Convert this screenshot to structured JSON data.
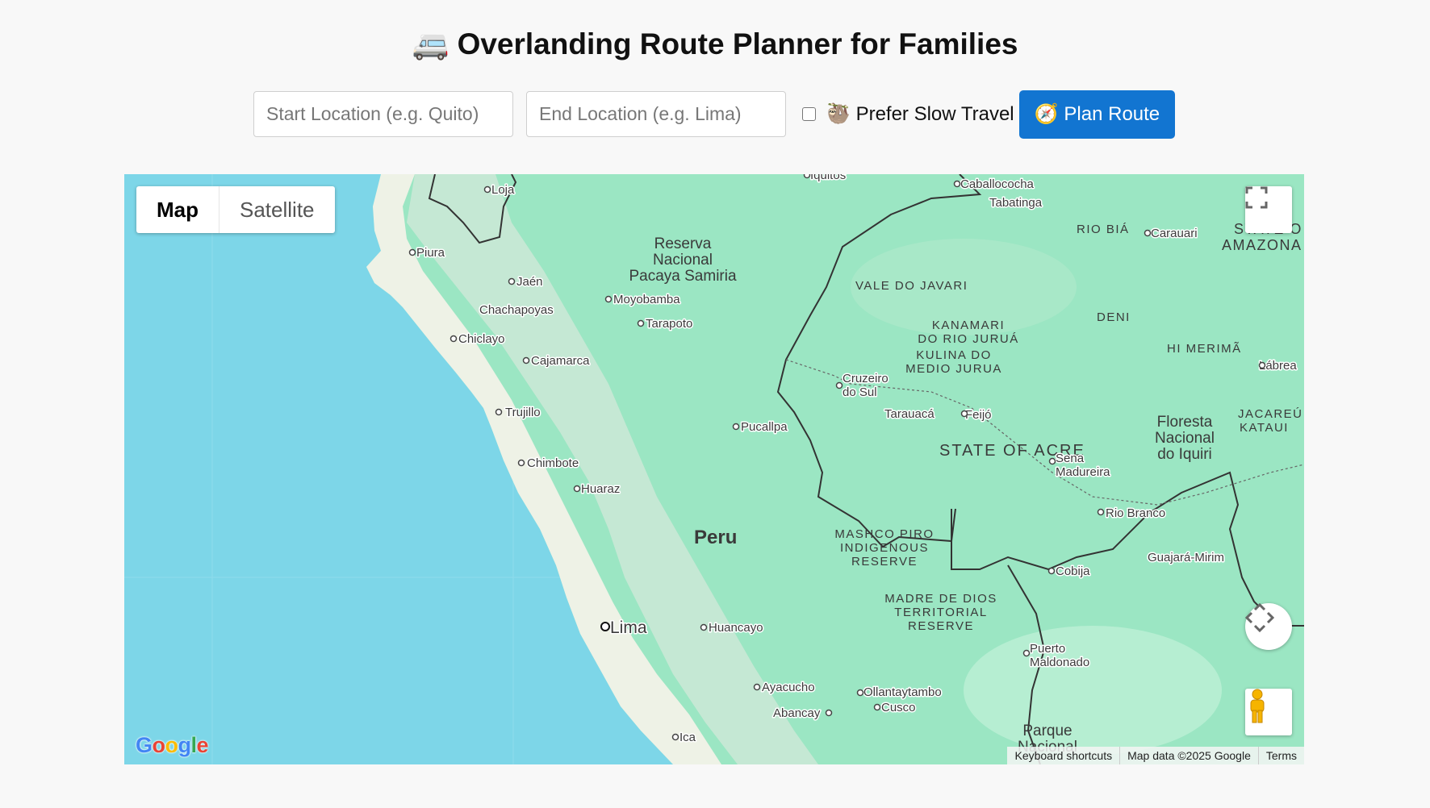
{
  "header": {
    "emoji": "🚐",
    "title": "Overlanding Route Planner for Families"
  },
  "form": {
    "start_placeholder": "Start Location (e.g. Quito)",
    "end_placeholder": "End Location (e.g. Lima)",
    "slow_travel_emoji": "🦥",
    "slow_travel_label": "Prefer Slow Travel",
    "slow_travel_checked": false,
    "plan_button_emoji": "🧭",
    "plan_button_label": "Plan Route"
  },
  "map": {
    "type_buttons": {
      "map": "Map",
      "satellite": "Satellite",
      "selected": "Map"
    },
    "logo": "Google",
    "attribution": {
      "shortcuts": "Keyboard shortcuts",
      "data": "Map data ©2025 Google",
      "terms": "Terms"
    },
    "colors": {
      "water": "#7dd6e8",
      "land": "#9be6c3",
      "coast": "#eef2e6",
      "brand_blue": "#1275d1"
    },
    "labels": {
      "loja": "Loja",
      "iquitos": "Iquitos",
      "caballococha": "Caballococha",
      "tabatinga": "Tabatinga",
      "rio_bia": "RIO BIÁ",
      "carauari": "Carauari",
      "estado_amazonas_1": "STATE O",
      "estado_amazonas_2": "AMAZONA",
      "piura": "Piura",
      "jaen": "Jaén",
      "reserva_1": "Reserva",
      "reserva_2": "Nacional",
      "reserva_3": "Pacaya Samiria",
      "vale_do_javari": "VALE DO JAVARI",
      "chachapoyas": "Chachapoyas",
      "moyobamba": "Moyobamba",
      "tarapoto": "Tarapoto",
      "kanamari_1": "KANAMARI",
      "kanamari_2": "DO RIO JURUÁ",
      "deni": "DENI",
      "chiclayo": "Chiclayo",
      "kulina_1": "KULINA DO",
      "kulina_2": "MEDIO JURUA",
      "hi_merima": "HI MERIMÃ",
      "labrea": "Lábrea",
      "cajamarca": "Cajamarca",
      "cruzeiro_1": "Cruzeiro",
      "cruzeiro_2": "do Sul",
      "trujillo": "Trujillo",
      "tarauaca": "Tarauacá",
      "feijo": "Feijó",
      "floresta_1": "Floresta",
      "floresta_2": "Nacional",
      "floresta_3": "do Iquiri",
      "jacareuba_1": "JACAREÚ",
      "jacareuba_2": "KATAUI",
      "pucallpa": "Pucallpa",
      "state_of_acre": "STATE OF ACRE",
      "chimbote": "Chimbote",
      "sena_1": "Sena",
      "sena_2": "Madureira",
      "huaraz": "Huaraz",
      "rio_branco": "Rio Branco",
      "peru": "Peru",
      "mashco_1": "MASHCO PIRO",
      "mashco_2": "INDIGENOUS",
      "mashco_3": "RESERVE",
      "guajara": "Guajará-Mirim",
      "cobija": "Cobija",
      "madre_1": "MADRE DE DIOS",
      "madre_2": "TERRITORIAL",
      "madre_3": "RESERVE",
      "lima": "Lima",
      "huancayo": "Huancayo",
      "puerto_1": "Puerto",
      "puerto_2": "Maldonado",
      "ayacucho": "Ayacucho",
      "ollantaytambo": "Ollantaytambo",
      "cusco": "Cusco",
      "abancay": "Abancay",
      "ica": "Ica",
      "parque_1": "Parque",
      "parque_2": "Nacional"
    }
  }
}
